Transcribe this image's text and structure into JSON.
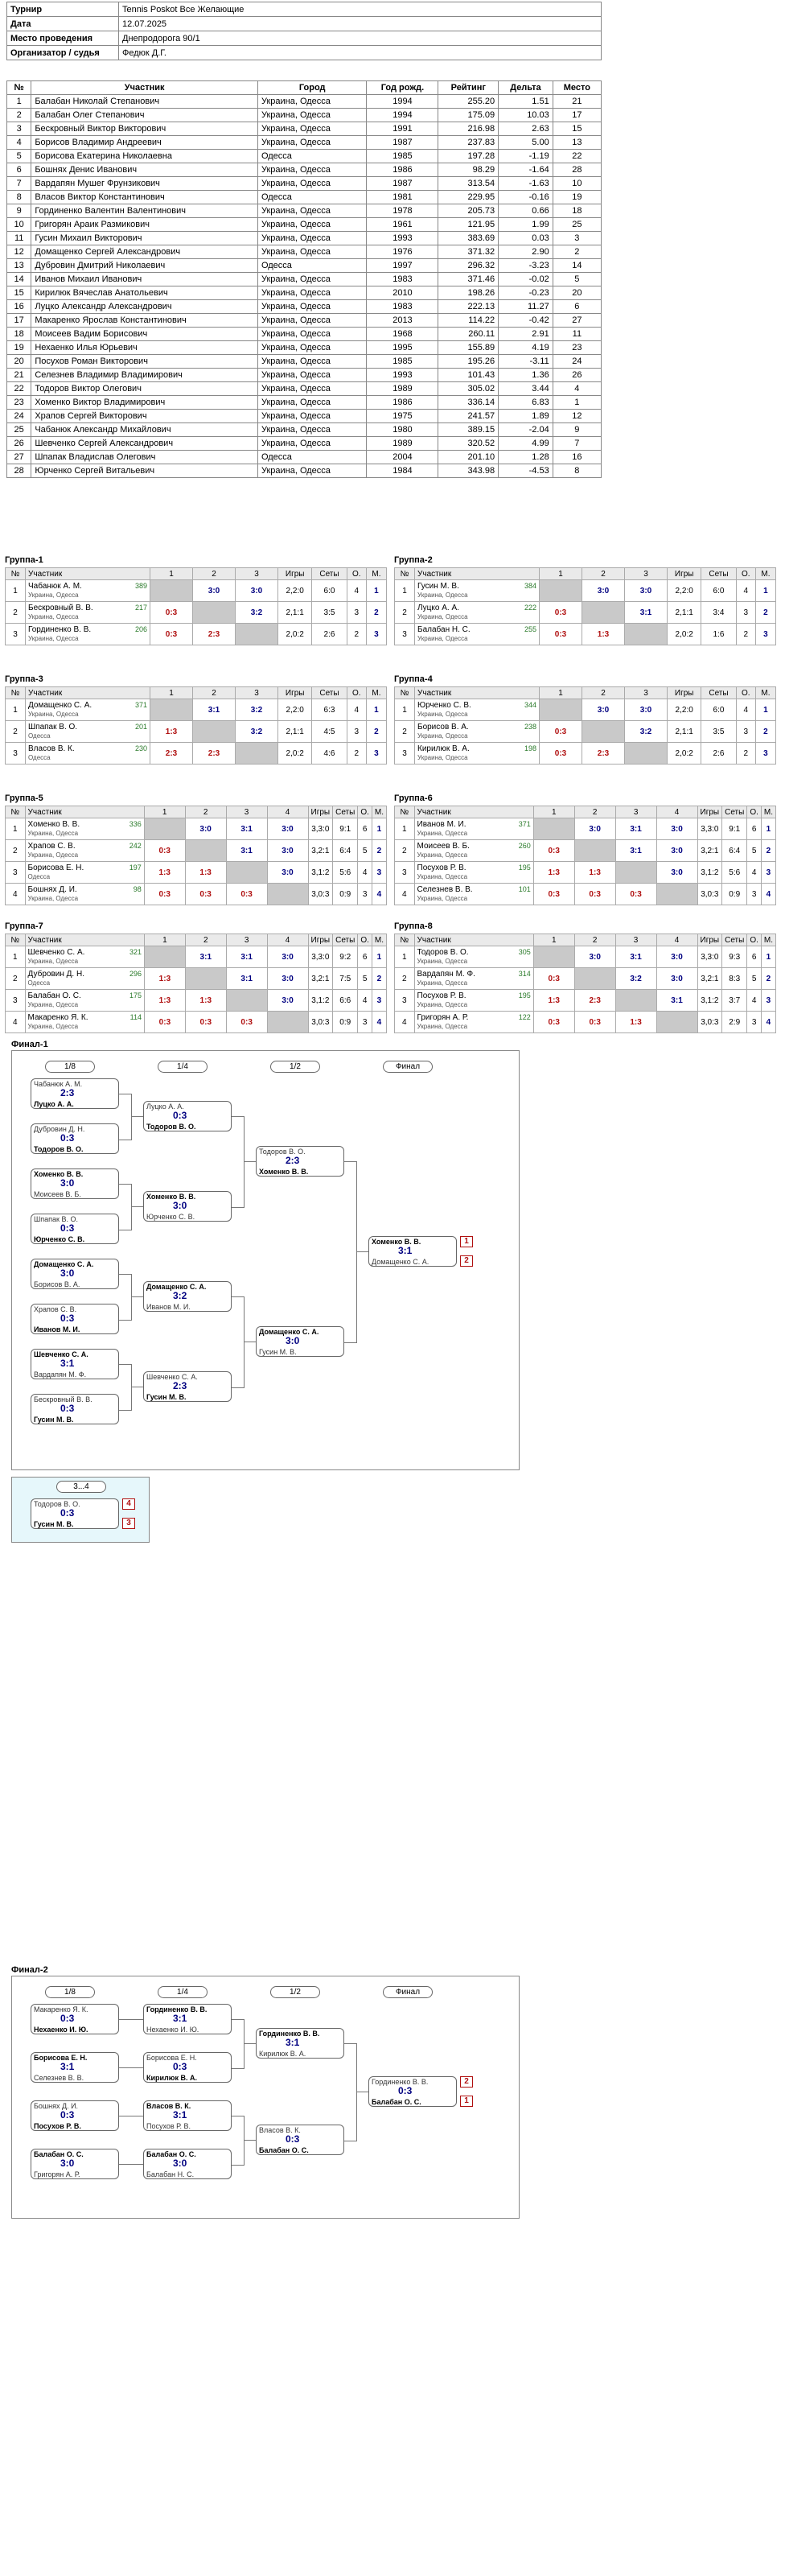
{
  "info": [
    {
      "k": "Турнир",
      "v": "Tennis Poskot Все Желающие"
    },
    {
      "k": "Дата",
      "v": "12.07.2025"
    },
    {
      "k": "Место проведения",
      "v": "Днепродорога 90/1"
    },
    {
      "k": "Организатор / судья",
      "v": "Федюк Д.Г."
    }
  ],
  "participants": {
    "headers": [
      "№",
      "Участник",
      "Город",
      "Год рожд.",
      "Рейтинг",
      "Дельта",
      "Место"
    ],
    "rows": [
      [
        "1",
        "Балабан Николай Степанович",
        "Украина, Одесса",
        "1994",
        "255.20",
        "1.51",
        "21"
      ],
      [
        "2",
        "Балабан Олег Степанович",
        "Украина, Одесса",
        "1994",
        "175.09",
        "10.03",
        "17"
      ],
      [
        "3",
        "Бескровный Виктор Викторович",
        "Украина, Одесса",
        "1991",
        "216.98",
        "2.63",
        "15"
      ],
      [
        "4",
        "Борисов Владимир Андреевич",
        "Украина, Одесса",
        "1987",
        "237.83",
        "5.00",
        "13"
      ],
      [
        "5",
        "Борисова Екатерина Николаевна",
        "Одесса",
        "1985",
        "197.28",
        "-1.19",
        "22"
      ],
      [
        "6",
        "Бошнях Денис Иванович",
        "Украина, Одесса",
        "1986",
        "98.29",
        "-1.64",
        "28"
      ],
      [
        "7",
        "Вардапян Мушег Фрунзикович",
        "Украина, Одесса",
        "1987",
        "313.54",
        "-1.63",
        "10"
      ],
      [
        "8",
        "Власов Виктор Константинович",
        "Одесса",
        "1981",
        "229.95",
        "-0.16",
        "19"
      ],
      [
        "9",
        "Гординенко Валентин Валентинович",
        "Украина, Одесса",
        "1978",
        "205.73",
        "0.66",
        "18"
      ],
      [
        "10",
        "Григорян Араик Размикович",
        "Украина, Одесса",
        "1961",
        "121.95",
        "1.99",
        "25"
      ],
      [
        "11",
        "Гусин Михаил Викторович",
        "Украина, Одесса",
        "1993",
        "383.69",
        "0.03",
        "3"
      ],
      [
        "12",
        "Домащенко Сергей Александрович",
        "Украина, Одесса",
        "1976",
        "371.32",
        "2.90",
        "2"
      ],
      [
        "13",
        "Дубровин Дмитрий Николаевич",
        "Одесса",
        "1997",
        "296.32",
        "-3.23",
        "14"
      ],
      [
        "14",
        "Иванов Михаил Иванович",
        "Украина, Одесса",
        "1983",
        "371.46",
        "-0.02",
        "5"
      ],
      [
        "15",
        "Кирилюк Вячеслав Анатольевич",
        "Украина, Одесса",
        "2010",
        "198.26",
        "-0.23",
        "20"
      ],
      [
        "16",
        "Луцко Александр Александрович",
        "Украина, Одесса",
        "1983",
        "222.13",
        "11.27",
        "6"
      ],
      [
        "17",
        "Макаренко Ярослав Константинович",
        "Украина, Одесса",
        "2013",
        "114.22",
        "-0.42",
        "27"
      ],
      [
        "18",
        "Моисеев Вадим Борисович",
        "Украина, Одесса",
        "1968",
        "260.11",
        "2.91",
        "11"
      ],
      [
        "19",
        "Нехаенко Илья Юрьевич",
        "Украина, Одесса",
        "1995",
        "155.89",
        "4.19",
        "23"
      ],
      [
        "20",
        "Посухов Роман Викторович",
        "Украина, Одесса",
        "1985",
        "195.26",
        "-3.11",
        "24"
      ],
      [
        "21",
        "Селезнев Владимир Владимирович",
        "Украина, Одесса",
        "1993",
        "101.43",
        "1.36",
        "26"
      ],
      [
        "22",
        "Тодоров Виктор Олегович",
        "Украина, Одесса",
        "1989",
        "305.02",
        "3.44",
        "4"
      ],
      [
        "23",
        "Хоменко Виктор Владимирович",
        "Украина, Одесса",
        "1986",
        "336.14",
        "6.83",
        "1"
      ],
      [
        "24",
        "Храпов Сергей Викторович",
        "Украина, Одесса",
        "1975",
        "241.57",
        "1.89",
        "12"
      ],
      [
        "25",
        "Чабанюк Александр Михайлович",
        "Украина, Одесса",
        "1980",
        "389.15",
        "-2.04",
        "9"
      ],
      [
        "26",
        "Шевченко Сергей Александрович",
        "Украина, Одесса",
        "1989",
        "320.52",
        "4.99",
        "7"
      ],
      [
        "27",
        "Шпапак Владислав Олегович",
        "Одесса",
        "2004",
        "201.10",
        "1.28",
        "16"
      ],
      [
        "28",
        "Юрченко Сергей Витальевич",
        "Украина, Одесса",
        "1984",
        "343.98",
        "-4.53",
        "8"
      ]
    ]
  },
  "groups": [
    {
      "title": "Группа-1",
      "n": 3,
      "players": [
        {
          "name": "Чабанюк А. М.",
          "city": "Украина, Одесса",
          "rating": "389",
          "res": [
            "",
            "3:0",
            "3:0"
          ],
          "games": "2,2:0",
          "sets": "6:0",
          "o": "4",
          "m": "1"
        },
        {
          "name": "Бескровный В. В.",
          "city": "Украина, Одесса",
          "rating": "217",
          "res": [
            "0:3",
            "",
            "3:2"
          ],
          "games": "2,1:1",
          "sets": "3:5",
          "o": "3",
          "m": "2"
        },
        {
          "name": "Гординенко В. В.",
          "city": "Украина, Одесса",
          "rating": "206",
          "res": [
            "0:3",
            "2:3",
            ""
          ],
          "games": "2,0:2",
          "sets": "2:6",
          "o": "2",
          "m": "3"
        }
      ]
    },
    {
      "title": "Группа-2",
      "n": 3,
      "players": [
        {
          "name": "Гусин М. В.",
          "city": "Украина, Одесса",
          "rating": "384",
          "res": [
            "",
            "3:0",
            "3:0"
          ],
          "games": "2,2:0",
          "sets": "6:0",
          "o": "4",
          "m": "1"
        },
        {
          "name": "Луцко А. А.",
          "city": "Украина, Одесса",
          "rating": "222",
          "res": [
            "0:3",
            "",
            "3:1"
          ],
          "games": "2,1:1",
          "sets": "3:4",
          "o": "3",
          "m": "2"
        },
        {
          "name": "Балабан Н. С.",
          "city": "Украина, Одесса",
          "rating": "255",
          "res": [
            "0:3",
            "1:3",
            ""
          ],
          "games": "2,0:2",
          "sets": "1:6",
          "o": "2",
          "m": "3"
        }
      ]
    },
    {
      "title": "Группа-3",
      "n": 3,
      "players": [
        {
          "name": "Домащенко С. А.",
          "city": "Украина, Одесса",
          "rating": "371",
          "res": [
            "",
            "3:1",
            "3:2"
          ],
          "games": "2,2:0",
          "sets": "6:3",
          "o": "4",
          "m": "1"
        },
        {
          "name": "Шпапак В. О.",
          "city": "Одесса",
          "rating": "201",
          "res": [
            "1:3",
            "",
            "3:2"
          ],
          "games": "2,1:1",
          "sets": "4:5",
          "o": "3",
          "m": "2"
        },
        {
          "name": "Власов В. К.",
          "city": "Одесса",
          "rating": "230",
          "res": [
            "2:3",
            "2:3",
            ""
          ],
          "games": "2,0:2",
          "sets": "4:6",
          "o": "2",
          "m": "3"
        }
      ]
    },
    {
      "title": "Группа-4",
      "n": 3,
      "players": [
        {
          "name": "Юрченко С. В.",
          "city": "Украина, Одесса",
          "rating": "344",
          "res": [
            "",
            "3:0",
            "3:0"
          ],
          "games": "2,2:0",
          "sets": "6:0",
          "o": "4",
          "m": "1"
        },
        {
          "name": "Борисов В. А.",
          "city": "Украина, Одесса",
          "rating": "238",
          "res": [
            "0:3",
            "",
            "3:2"
          ],
          "games": "2,1:1",
          "sets": "3:5",
          "o": "3",
          "m": "2"
        },
        {
          "name": "Кирилюк В. А.",
          "city": "Украина, Одесса",
          "rating": "198",
          "res": [
            "0:3",
            "2:3",
            ""
          ],
          "games": "2,0:2",
          "sets": "2:6",
          "o": "2",
          "m": "3"
        }
      ]
    },
    {
      "title": "Группа-5",
      "n": 4,
      "players": [
        {
          "name": "Хоменко В. В.",
          "city": "Украина, Одесса",
          "rating": "336",
          "res": [
            "",
            "3:0",
            "3:1",
            "3:0"
          ],
          "games": "3,3:0",
          "sets": "9:1",
          "o": "6",
          "m": "1"
        },
        {
          "name": "Храпов С. В.",
          "city": "Украина, Одесса",
          "rating": "242",
          "res": [
            "0:3",
            "",
            "3:1",
            "3:0"
          ],
          "games": "3,2:1",
          "sets": "6:4",
          "o": "5",
          "m": "2"
        },
        {
          "name": "Борисова Е. Н.",
          "city": "Одесса",
          "rating": "197",
          "res": [
            "1:3",
            "1:3",
            "",
            "3:0"
          ],
          "games": "3,1:2",
          "sets": "5:6",
          "o": "4",
          "m": "3"
        },
        {
          "name": "Бошнях Д. И.",
          "city": "Украина, Одесса",
          "rating": "98",
          "res": [
            "0:3",
            "0:3",
            "0:3",
            ""
          ],
          "games": "3,0:3",
          "sets": "0:9",
          "o": "3",
          "m": "4"
        }
      ]
    },
    {
      "title": "Группа-6",
      "n": 4,
      "players": [
        {
          "name": "Иванов М. И.",
          "city": "Украина, Одесса",
          "rating": "371",
          "res": [
            "",
            "3:0",
            "3:1",
            "3:0"
          ],
          "games": "3,3:0",
          "sets": "9:1",
          "o": "6",
          "m": "1"
        },
        {
          "name": "Моисеев В. Б.",
          "city": "Украина, Одесса",
          "rating": "260",
          "res": [
            "0:3",
            "",
            "3:1",
            "3:0"
          ],
          "games": "3,2:1",
          "sets": "6:4",
          "o": "5",
          "m": "2"
        },
        {
          "name": "Посухов Р. В.",
          "city": "Украина, Одесса",
          "rating": "195",
          "res": [
            "1:3",
            "1:3",
            "",
            "3:0"
          ],
          "games": "3,1:2",
          "sets": "5:6",
          "o": "4",
          "m": "3"
        },
        {
          "name": "Селезнев В. В.",
          "city": "Украина, Одесса",
          "rating": "101",
          "res": [
            "0:3",
            "0:3",
            "0:3",
            ""
          ],
          "games": "3,0:3",
          "sets": "0:9",
          "o": "3",
          "m": "4"
        }
      ]
    },
    {
      "title": "Группа-7",
      "n": 4,
      "players": [
        {
          "name": "Шевченко С. А.",
          "city": "Украина, Одесса",
          "rating": "321",
          "res": [
            "",
            "3:1",
            "3:1",
            "3:0"
          ],
          "games": "3,3:0",
          "sets": "9:2",
          "o": "6",
          "m": "1"
        },
        {
          "name": "Дубровин Д. Н.",
          "city": "Одесса",
          "rating": "296",
          "res": [
            "1:3",
            "",
            "3:1",
            "3:0"
          ],
          "games": "3,2:1",
          "sets": "7:5",
          "o": "5",
          "m": "2"
        },
        {
          "name": "Балабан О. С.",
          "city": "Украина, Одесса",
          "rating": "175",
          "res": [
            "1:3",
            "1:3",
            "",
            "3:0"
          ],
          "games": "3,1:2",
          "sets": "6:6",
          "o": "4",
          "m": "3"
        },
        {
          "name": "Макаренко Я. К.",
          "city": "Украина, Одесса",
          "rating": "114",
          "res": [
            "0:3",
            "0:3",
            "0:3",
            ""
          ],
          "games": "3,0:3",
          "sets": "0:9",
          "o": "3",
          "m": "4"
        }
      ]
    },
    {
      "title": "Группа-8",
      "n": 4,
      "players": [
        {
          "name": "Тодоров В. О.",
          "city": "Украина, Одесса",
          "rating": "305",
          "res": [
            "",
            "3:0",
            "3:1",
            "3:0"
          ],
          "games": "3,3:0",
          "sets": "9:3",
          "o": "6",
          "m": "1"
        },
        {
          "name": "Вардапян М. Ф.",
          "city": "Украина, Одесса",
          "rating": "314",
          "res": [
            "0:3",
            "",
            "3:2",
            "3:0"
          ],
          "games": "3,2:1",
          "sets": "8:3",
          "o": "5",
          "m": "2"
        },
        {
          "name": "Посухов Р. В.",
          "city": "Украина, Одесса",
          "rating": "195",
          "res": [
            "1:3",
            "2:3",
            "",
            "3:1"
          ],
          "games": "3,1:2",
          "sets": "3:7",
          "o": "4",
          "m": "3"
        },
        {
          "name": "Григорян А. Р.",
          "city": "Украина, Одесса",
          "rating": "122",
          "res": [
            "0:3",
            "0:3",
            "1:3",
            ""
          ],
          "games": "3,0:3",
          "sets": "2:9",
          "o": "3",
          "m": "4"
        }
      ]
    }
  ],
  "group_headers": {
    "num": "№",
    "player": "Участник",
    "games": "Игры",
    "sets": "Сеты",
    "o": "О.",
    "m": "М."
  },
  "final1": {
    "title": "Финал-1",
    "rounds": [
      "1/8",
      "1/4",
      "1/2",
      "Финал"
    ],
    "r1": [
      {
        "a": "Чабанюк А. М.",
        "b": "Луцко А. А.",
        "s": "2:3",
        "w": "b",
        "n": "21",
        "sa": "1",
        "sb": "16"
      },
      {
        "a": "Дубровин Д. Н.",
        "b": "Тодоров В. О.",
        "s": "0:3",
        "w": "b",
        "n": "22",
        "sa": "9",
        "sb": "8"
      },
      {
        "a": "Хоменко В. В.",
        "b": "Моисеев В. Б.",
        "s": "3:0",
        "w": "a",
        "n": "23",
        "sa": "5",
        "sb": "12"
      },
      {
        "a": "Шпапак В. О.",
        "b": "Юрченко С. В.",
        "s": "0:3",
        "w": "b",
        "n": "24",
        "sa": "13",
        "sb": "4"
      },
      {
        "a": "Домащенко С. А.",
        "b": "Борисов В. А.",
        "s": "3:0",
        "w": "a",
        "n": "25",
        "sa": "3",
        "sb": "14"
      },
      {
        "a": "Храпов С. В.",
        "b": "Иванов М. И.",
        "s": "0:3",
        "w": "b",
        "n": "26",
        "sa": "11",
        "sb": "6"
      },
      {
        "a": "Шевченко С. А.",
        "b": "Вардапян М. Ф.",
        "s": "3:1",
        "w": "a",
        "n": "27",
        "sa": "7",
        "sb": "10"
      },
      {
        "a": "Бескровный В. В.",
        "b": "Гусин М. В.",
        "s": "0:3",
        "w": "b",
        "n": "28",
        "sa": "15",
        "sb": "2"
      }
    ],
    "r2": [
      {
        "a": "Луцко А. А.",
        "b": "Тодоров В. О.",
        "s": "0:3",
        "w": "b",
        "n": "9"
      },
      {
        "a": "Хоменко В. В.",
        "b": "Юрченко С. В.",
        "s": "3:0",
        "w": "a",
        "n": "10"
      },
      {
        "a": "Домащенко С. А.",
        "b": "Иванов М. И.",
        "s": "3:2",
        "w": "a",
        "n": "11"
      },
      {
        "a": "Шевченко С. А.",
        "b": "Гусин М. В.",
        "s": "2:3",
        "w": "b",
        "n": "12"
      }
    ],
    "r3": [
      {
        "a": "Тодоров В. О.",
        "b": "Хоменко В. В.",
        "s": "2:3",
        "w": "b",
        "n": "13"
      },
      {
        "a": "Домащенко С. А.",
        "b": "Гусин М. В.",
        "s": "3:0",
        "w": "a",
        "n": "14"
      }
    ],
    "fin": {
      "a": "Хоменко В. В.",
      "b": "Домащенко С. А.",
      "s": "3:1",
      "p1": "1",
      "p2": "2",
      "n": "15"
    },
    "third": {
      "title": "3...4",
      "a": "Тодоров В. О.",
      "b": "Гусин М. В.",
      "s": "0:3",
      "pa": "4",
      "pb": "3",
      "n": "16",
      "sa": "-13",
      "sb": "-14"
    }
  },
  "final2": {
    "title": "Финал-2",
    "rounds": [
      "1/8",
      "1/4",
      "1/2",
      "Финал"
    ],
    "r1": [
      {
        "a": "Макаренко Я. К.",
        "b": "Нехаенко И. Ю.",
        "s": "0:3",
        "w": "b",
        "n": "1",
        "sa": "",
        "sb": "8"
      },
      {
        "a": "Борисова Е. Н.",
        "b": "Селезнев В. В.",
        "s": "3:1",
        "w": "a",
        "n": "2",
        "sa": "5",
        "sb": "4"
      },
      {
        "a": "Бошнях Д. И.",
        "b": "Посухов Р. В.",
        "s": "0:3",
        "w": "b",
        "n": "3",
        "sa": "3",
        "sb": "6"
      },
      {
        "a": "Балабан О. С.",
        "b": "Григорян А. Р.",
        "s": "3:0",
        "w": "a",
        "n": "4",
        "sa": "7",
        "sb": "2"
      }
    ],
    "r2": [
      {
        "a": "Гординенко В. В.",
        "b": "Нехаенко И. Ю.",
        "s": "3:1",
        "w": "a",
        "n": "5"
      },
      {
        "a": "Борисова Е. Н.",
        "b": "Кирилюк В. А.",
        "s": "0:3",
        "w": "b",
        "n": "6"
      },
      {
        "a": "Власов В. К.",
        "b": "Посухов Р. В.",
        "s": "3:1",
        "w": "a",
        "n": "7"
      },
      {
        "a": "Балабан О. С.",
        "b": "Балабан Н. С.",
        "s": "3:0",
        "w": "a",
        "n": "8"
      }
    ],
    "r3": [
      {
        "a": "Гординенко В. В.",
        "b": "Кирилюк В. А.",
        "s": "3:1",
        "w": "a",
        "n": "9"
      },
      {
        "a": "Власов В. К.",
        "b": "Балабан О. С.",
        "s": "0:3",
        "w": "b",
        "n": "10"
      }
    ],
    "fin": {
      "a": "Гординенко В. В.",
      "b": "Балабан О. С.",
      "s": "0:3",
      "p1": "2",
      "p2": "1",
      "n": "11"
    }
  }
}
